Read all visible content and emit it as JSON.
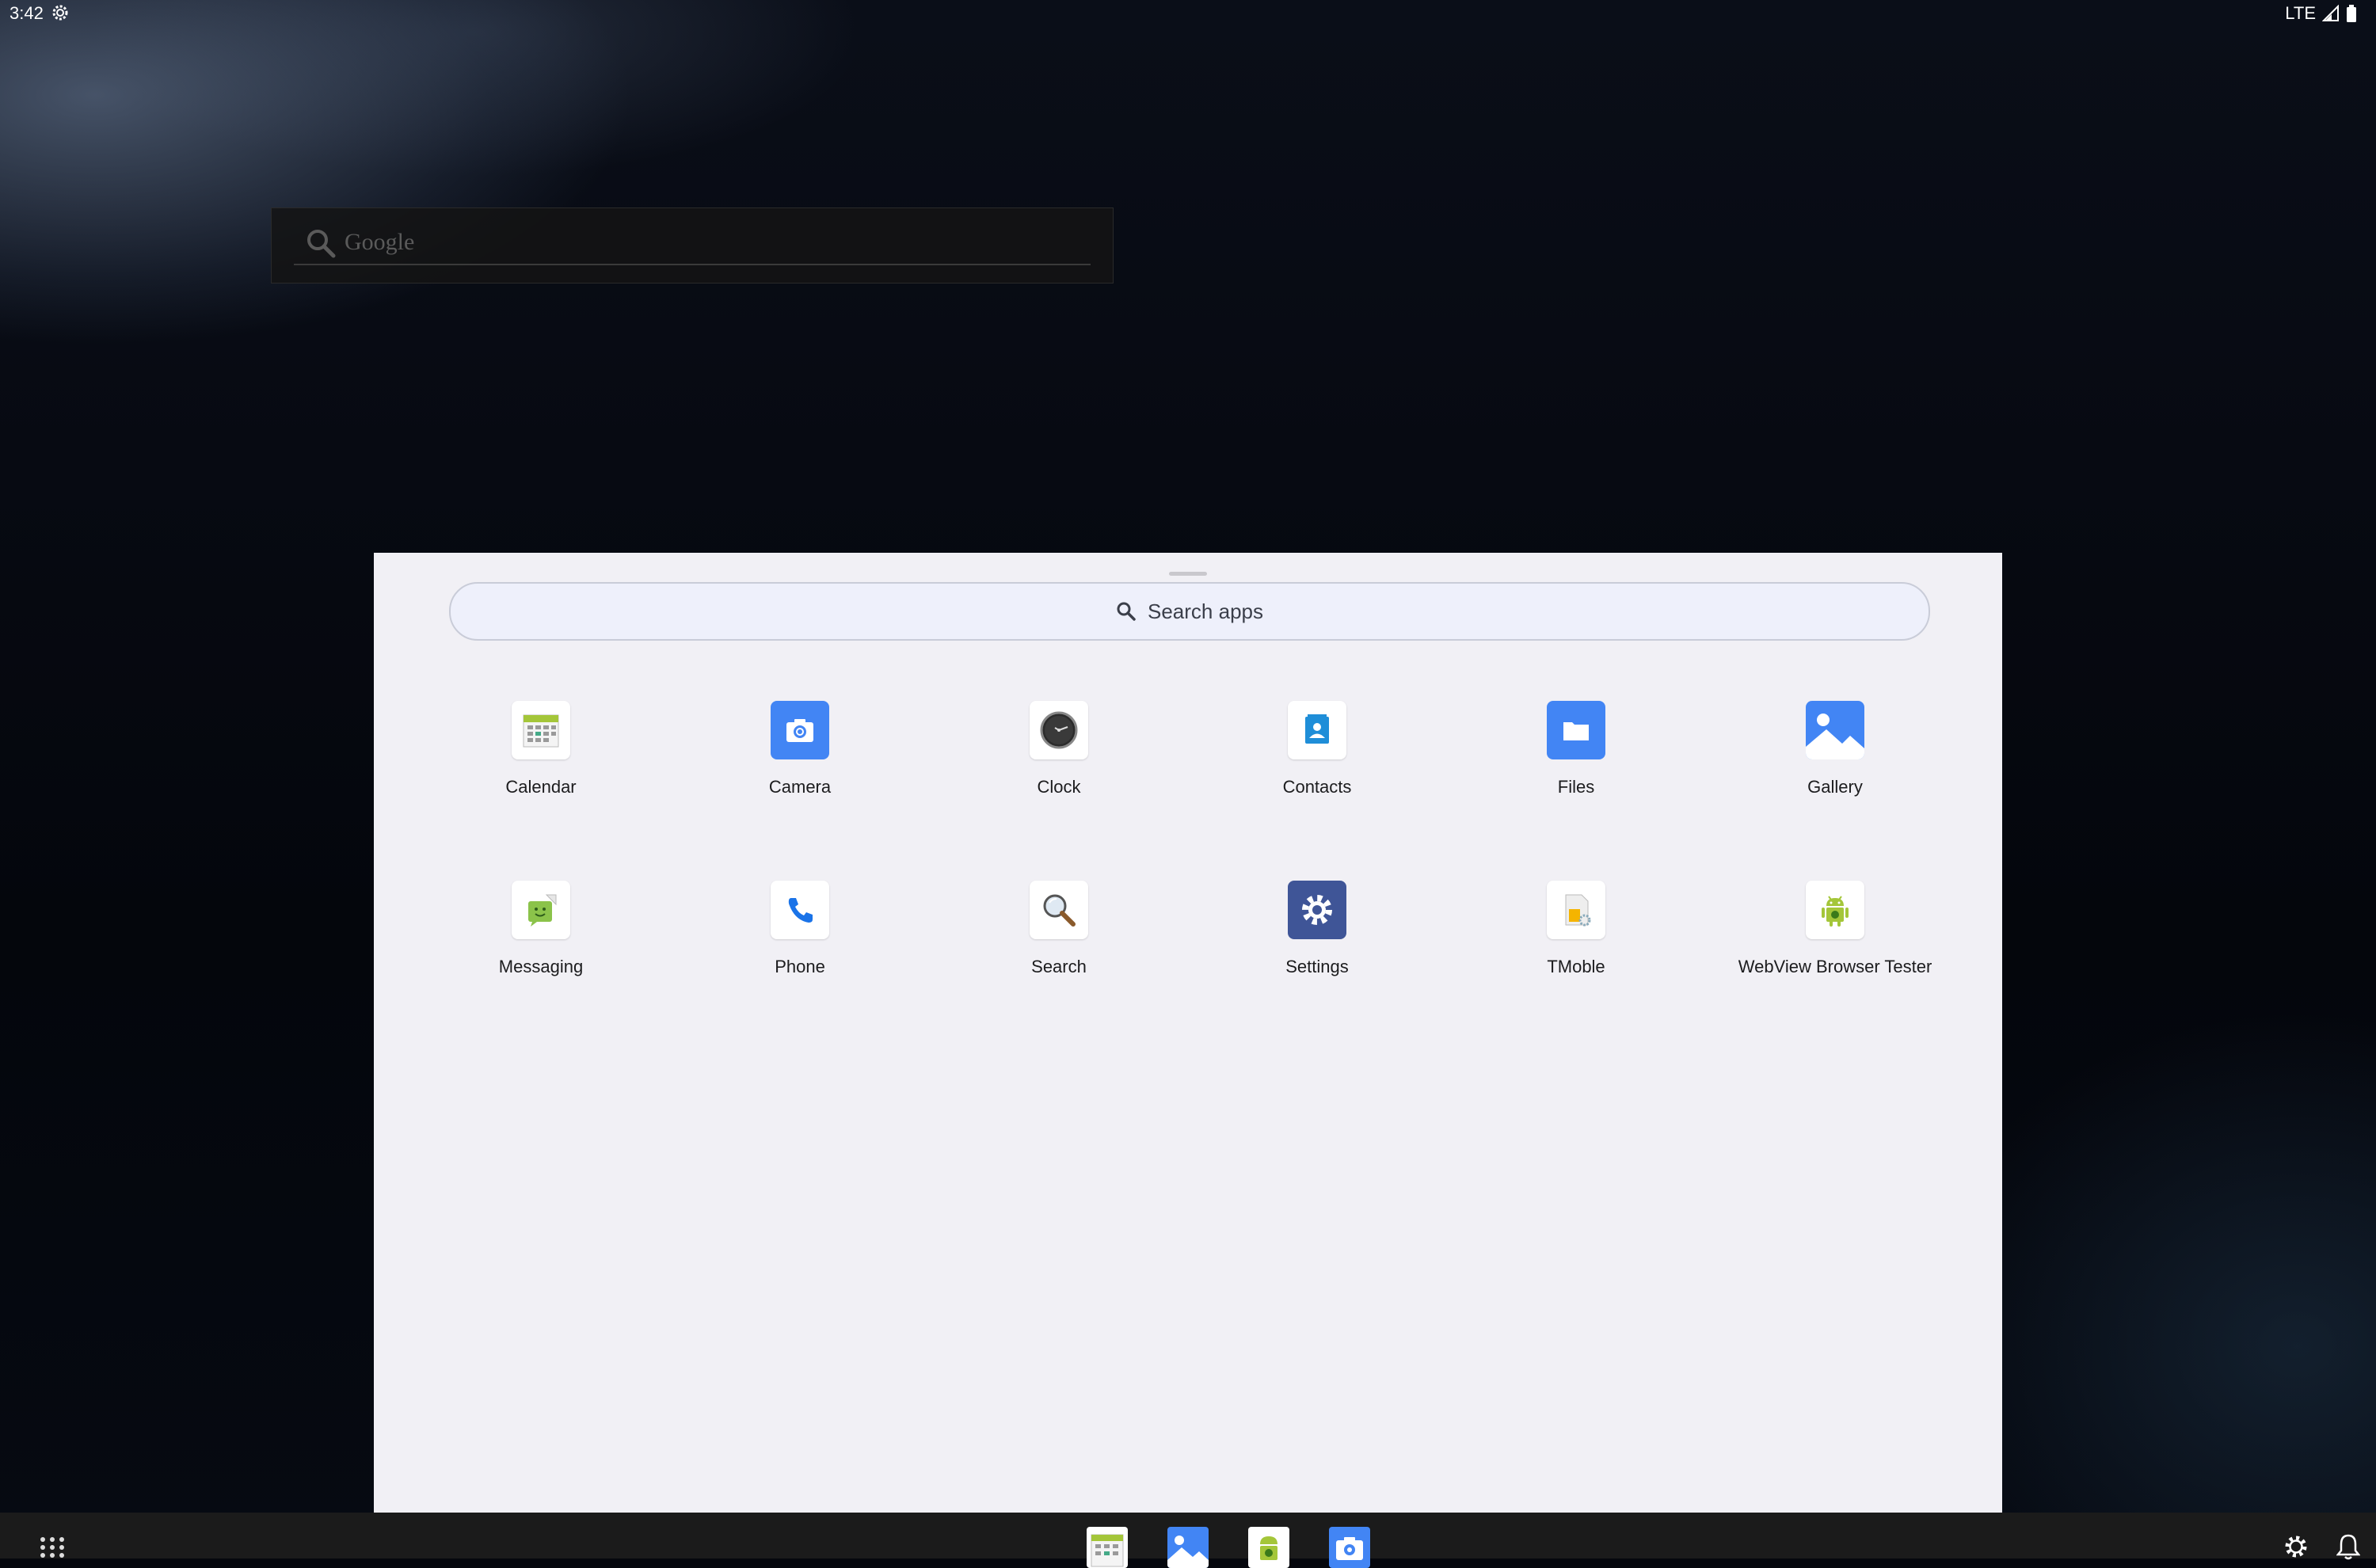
{
  "status_bar": {
    "time": "3:42",
    "network": "LTE",
    "icons": [
      "gear-icon",
      "signal-icon",
      "battery-icon"
    ]
  },
  "google_widget": {
    "text": "Google",
    "icon": "search-icon"
  },
  "app_drawer": {
    "search_label": "Search apps",
    "apps": [
      {
        "label": "Calendar",
        "icon": "calendar-icon"
      },
      {
        "label": "Camera",
        "icon": "camera-icon"
      },
      {
        "label": "Clock",
        "icon": "clock-icon"
      },
      {
        "label": "Contacts",
        "icon": "contacts-icon"
      },
      {
        "label": "Files",
        "icon": "folder-icon"
      },
      {
        "label": "Gallery",
        "icon": "gallery-icon"
      },
      {
        "label": "Messaging",
        "icon": "messaging-icon"
      },
      {
        "label": "Phone",
        "icon": "phone-icon"
      },
      {
        "label": "Search",
        "icon": "magnifier-icon"
      },
      {
        "label": "Settings",
        "icon": "settings-icon"
      },
      {
        "label": "TMoble",
        "icon": "tmoble-icon"
      },
      {
        "label": "WebView Browser Tester",
        "icon": "android-icon"
      }
    ]
  },
  "taskbar": {
    "dock_apps": [
      "calendar-icon",
      "gallery-icon",
      "android-icon",
      "camera-icon"
    ],
    "right_icons": [
      "settings-icon",
      "bell-icon"
    ]
  },
  "colors": {
    "accent_blue": "#4285f4",
    "drawer_bg": "#f1f0f5",
    "settings_bg": "#3f5597"
  }
}
